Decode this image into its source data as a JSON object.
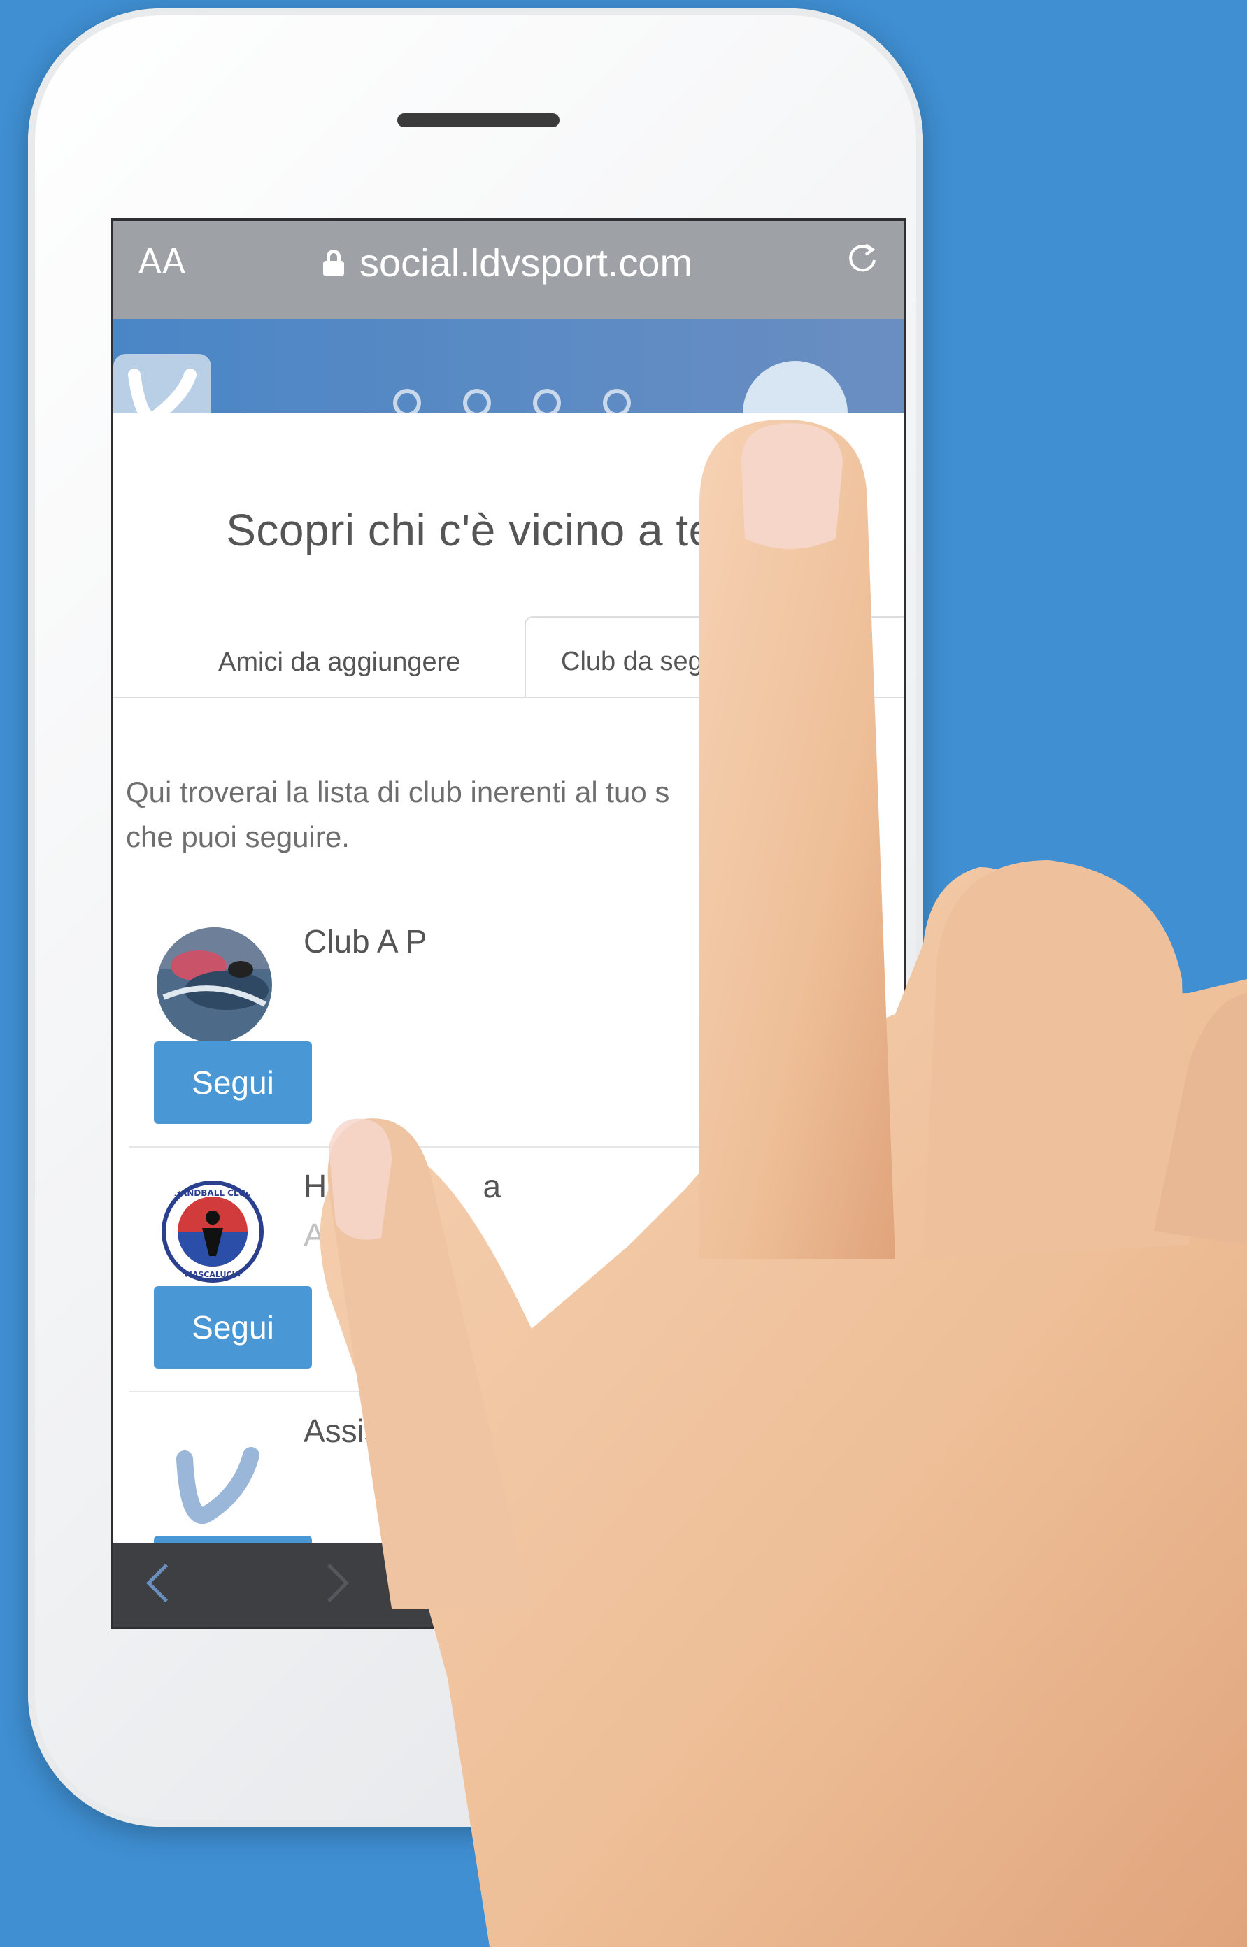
{
  "browser": {
    "text_size_label": "AA",
    "url": "social.ldvsport.com"
  },
  "modal": {
    "title": "Scopri chi c'è vicino a te",
    "tabs": [
      {
        "label": "Amici da aggiungere"
      },
      {
        "label": "Club da segu"
      }
    ],
    "description_line1": "Qui troverai la lista di club inerenti al tuo s",
    "description_line2": "che puoi seguire.",
    "clubs": [
      {
        "name": "Club A P",
        "subtitle": "",
        "follow_label": "Segui",
        "avatar": "swimmer-photo"
      },
      {
        "name": "HC",
        "name_tail": "a",
        "subtitle": "Asso",
        "follow_label": "Segui",
        "avatar": "handball-club-mascalucia-logo"
      },
      {
        "name": "Assis",
        "subtitle": "",
        "follow_label": "",
        "avatar": "ldv-logo"
      }
    ]
  },
  "logo_text": {
    "handball_top": "HANDBALL CLUB",
    "handball_bottom": "MASCALUCIA"
  },
  "colors": {
    "background": "#3f8fd2",
    "follow_button": "#4a97d6",
    "header": "#4a86c6"
  }
}
